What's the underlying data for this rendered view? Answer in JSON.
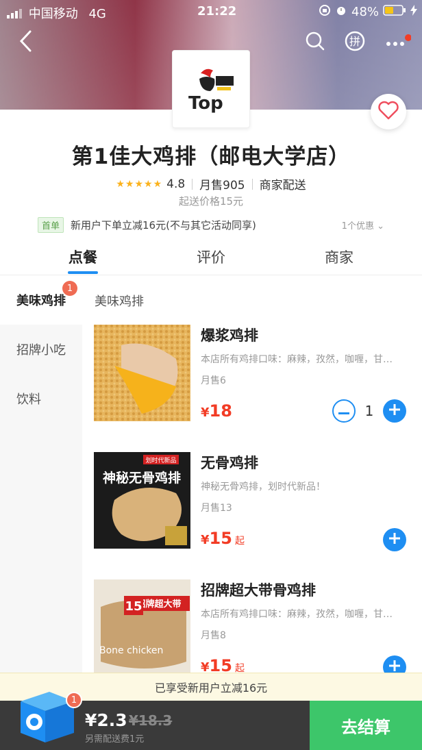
{
  "status_bar": {
    "carrier": "中国移动",
    "network": "4G",
    "time": "21:22",
    "battery": "48%"
  },
  "nav": {
    "back_icon": "chevron-left-icon",
    "search_icon": "search-icon",
    "group_icon": "pin-group-icon",
    "more_icon": "more-icon"
  },
  "shop": {
    "name": "第1佳大鸡排（邮电大学店）",
    "logo_text": "Top",
    "rating": "4.8",
    "monthly_sales": "月售905",
    "delivery": "商家配送",
    "min_order": "起送价格15元"
  },
  "promo": {
    "tag": "首单",
    "text": "新用户下单立减16元(不与其它活动同享)",
    "more": "1个优惠"
  },
  "tabs": [
    {
      "label": "点餐"
    },
    {
      "label": "评价"
    },
    {
      "label": "商家"
    }
  ],
  "categories": [
    {
      "label": "美味鸡排",
      "badge": "1"
    },
    {
      "label": "招牌小吃"
    },
    {
      "label": "饮料"
    }
  ],
  "section_title": "美味鸡排",
  "dishes": [
    {
      "name": "爆浆鸡排",
      "desc": "本店所有鸡排口味：麻辣，孜然，咖喱，甘…",
      "sold": "月售6",
      "price": "18",
      "qty": "1",
      "suffix": ""
    },
    {
      "name": "无骨鸡排",
      "desc": "神秘无骨鸡排，划时代新品！",
      "sold": "月售13",
      "price": "15",
      "suffix": "起"
    },
    {
      "name": "招牌超大带骨鸡排",
      "desc": "本店所有鸡排口味：麻辣，孜然，咖喱，甘…",
      "sold": "月售8",
      "price": "15",
      "suffix": "起"
    }
  ],
  "dish_images": {
    "img2_line1": "划时代新品",
    "img2_big": "神秘无骨鸡排",
    "img3_price": "15",
    "img3_title": "招牌超大带",
    "img3_sub": "Bone chicken"
  },
  "notice": "已享受新用户立减16元",
  "cart": {
    "badge": "1",
    "total": "¥2.3",
    "original": "¥18.3",
    "fee": "另需配送费1元",
    "checkout": "去结算"
  },
  "colors": {
    "accent": "#1e8ef2",
    "price": "#f23c25",
    "checkout": "#3dc66a"
  }
}
